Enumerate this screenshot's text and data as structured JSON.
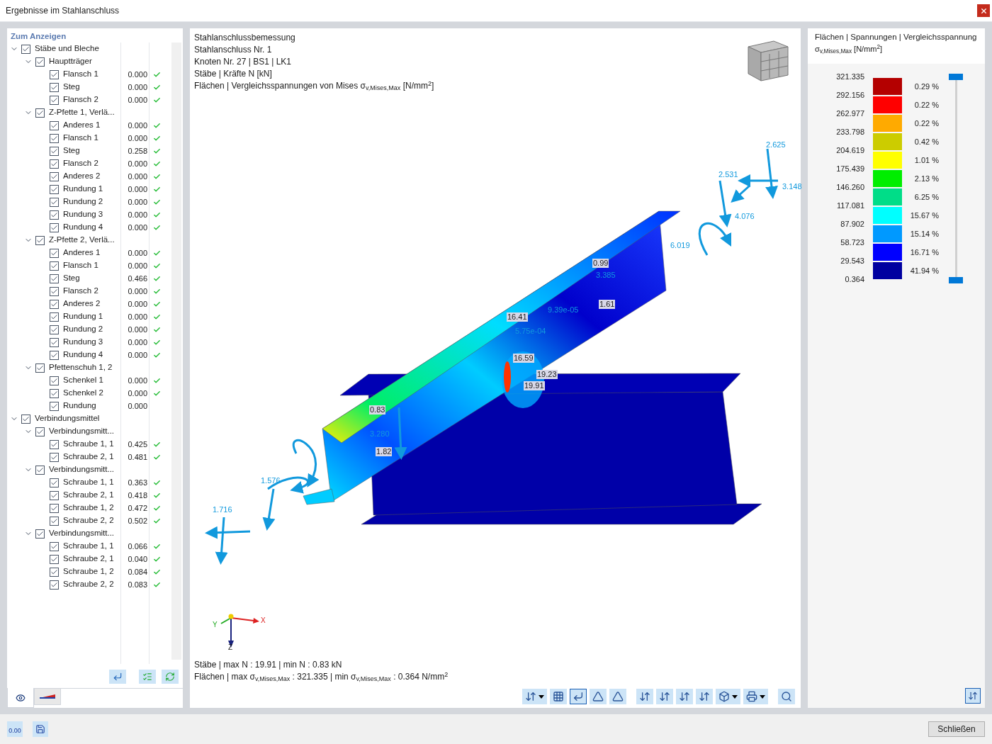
{
  "window": {
    "title": "Ergebnisse im Stahlanschluss"
  },
  "navigator": {
    "title": "Zum Anzeigen",
    "tree": [
      {
        "label": "Stäbe und Bleche",
        "checked": true,
        "expanded": true,
        "children": [
          {
            "label": "Hauptträger",
            "checked": true,
            "expanded": true,
            "children": [
              {
                "label": "Flansch 1",
                "checked": true,
                "value": "0.000",
                "ok": true
              },
              {
                "label": "Steg",
                "checked": true,
                "value": "0.000",
                "ok": true
              },
              {
                "label": "Flansch 2",
                "checked": true,
                "value": "0.000",
                "ok": true
              }
            ]
          },
          {
            "label": "Z-Pfette 1, Verlä...",
            "checked": true,
            "expanded": true,
            "children": [
              {
                "label": "Anderes 1",
                "checked": true,
                "value": "0.000",
                "ok": true
              },
              {
                "label": "Flansch 1",
                "checked": true,
                "value": "0.000",
                "ok": true
              },
              {
                "label": "Steg",
                "checked": true,
                "value": "0.258",
                "ok": true
              },
              {
                "label": "Flansch 2",
                "checked": true,
                "value": "0.000",
                "ok": true
              },
              {
                "label": "Anderes 2",
                "checked": true,
                "value": "0.000",
                "ok": true
              },
              {
                "label": "Rundung 1",
                "checked": true,
                "value": "0.000",
                "ok": true
              },
              {
                "label": "Rundung 2",
                "checked": true,
                "value": "0.000",
                "ok": true
              },
              {
                "label": "Rundung 3",
                "checked": true,
                "value": "0.000",
                "ok": true
              },
              {
                "label": "Rundung 4",
                "checked": true,
                "value": "0.000",
                "ok": true
              }
            ]
          },
          {
            "label": "Z-Pfette 2, Verlä...",
            "checked": true,
            "expanded": true,
            "children": [
              {
                "label": "Anderes 1",
                "checked": true,
                "value": "0.000",
                "ok": true
              },
              {
                "label": "Flansch 1",
                "checked": true,
                "value": "0.000",
                "ok": true
              },
              {
                "label": "Steg",
                "checked": true,
                "value": "0.466",
                "ok": true
              },
              {
                "label": "Flansch 2",
                "checked": true,
                "value": "0.000",
                "ok": true
              },
              {
                "label": "Anderes 2",
                "checked": true,
                "value": "0.000",
                "ok": true
              },
              {
                "label": "Rundung 1",
                "checked": true,
                "value": "0.000",
                "ok": true
              },
              {
                "label": "Rundung 2",
                "checked": true,
                "value": "0.000",
                "ok": true
              },
              {
                "label": "Rundung 3",
                "checked": true,
                "value": "0.000",
                "ok": true
              },
              {
                "label": "Rundung 4",
                "checked": true,
                "value": "0.000",
                "ok": true
              }
            ]
          },
          {
            "label": "Pfettenschuh 1, 2",
            "checked": true,
            "expanded": true,
            "children": [
              {
                "label": "Schenkel 1",
                "checked": true,
                "value": "0.000",
                "ok": true
              },
              {
                "label": "Schenkel 2",
                "checked": true,
                "value": "0.000",
                "ok": true
              },
              {
                "label": "Rundung",
                "checked": true,
                "value": "0.000",
                "ok": false
              }
            ]
          }
        ]
      },
      {
        "label": "Verbindungsmittel",
        "checked": true,
        "expanded": true,
        "children": [
          {
            "label": "Verbindungsmitt...",
            "checked": true,
            "expanded": true,
            "children": [
              {
                "label": "Schraube 1, 1",
                "checked": true,
                "value": "0.425",
                "ok": true
              },
              {
                "label": "Schraube 2, 1",
                "checked": true,
                "value": "0.481",
                "ok": true
              }
            ]
          },
          {
            "label": "Verbindungsmitt...",
            "checked": true,
            "expanded": true,
            "children": [
              {
                "label": "Schraube 1, 1",
                "checked": true,
                "value": "0.363",
                "ok": true
              },
              {
                "label": "Schraube 2, 1",
                "checked": true,
                "value": "0.418",
                "ok": true
              },
              {
                "label": "Schraube 1, 2",
                "checked": true,
                "value": "0.472",
                "ok": true
              },
              {
                "label": "Schraube 2, 2",
                "checked": true,
                "value": "0.502",
                "ok": true
              }
            ]
          },
          {
            "label": "Verbindungsmitt...",
            "checked": true,
            "expanded": true,
            "children": [
              {
                "label": "Schraube 1, 1",
                "checked": true,
                "value": "0.066",
                "ok": true
              },
              {
                "label": "Schraube 2, 1",
                "checked": true,
                "value": "0.040",
                "ok": true
              },
              {
                "label": "Schraube 1, 2",
                "checked": true,
                "value": "0.084",
                "ok": true
              },
              {
                "label": "Schraube 2, 2",
                "checked": true,
                "value": "0.083",
                "ok": true
              }
            ]
          }
        ]
      }
    ],
    "tabs": [
      {
        "kind": "visibility",
        "selected": true
      },
      {
        "kind": "colors",
        "selected": false
      }
    ]
  },
  "view": {
    "info": [
      "Stahlanschlussbemessung",
      "Stahlanschluss Nr. 1",
      "Knoten Nr. 27 | BS1 | LK1",
      "Stäbe | Kräfte N [kN]",
      "Flächen | Vergleichsspannungen von Mises σ$_{v,Mises,Max}$ [N/mm$^{2}$]"
    ],
    "member_labels": [
      "0.99",
      "1.61",
      "16.41",
      "16.59",
      "19.23",
      "19.91",
      "0.83",
      "1.82"
    ],
    "force_labels": [
      "2.625",
      "2.531",
      "3.148",
      "4.076",
      "6.019",
      "3.385",
      "9.39e-05",
      "5.75e-04",
      "3.280",
      "1.576",
      "1.716"
    ],
    "axes": {
      "x": "X",
      "y": "Y",
      "z": "Z"
    },
    "summary": [
      "Stäbe | max N : 19.91 | min N : 0.83 kN",
      "Flächen | max σ$_{v,Mises,Max}$ : 321.335 | min σ$_{v,Mises,Max}$ : 0.364 N/mm$^{2}$"
    ],
    "toolbar": [
      {
        "kind": "display",
        "selected": false
      },
      {
        "kind": "mesh",
        "selected": false
      },
      {
        "kind": "supports",
        "selected": true
      },
      {
        "kind": "loads",
        "selected": false
      },
      {
        "kind": "dimensions",
        "selected": false
      },
      {
        "kind": "view-x",
        "selected": false
      },
      {
        "kind": "view-y",
        "selected": false
      },
      {
        "kind": "view-z",
        "selected": false
      },
      {
        "kind": "view-minus-z",
        "selected": false
      },
      {
        "kind": "iso",
        "selected": false
      },
      {
        "kind": "print",
        "selected": false
      },
      {
        "kind": "reset",
        "selected": false
      }
    ]
  },
  "legend": {
    "title": "Flächen | Spannungen | Vergleichsspannung",
    "subtitle": "σ$_{v,Mises,Max}$ [N/mm$^{2}$]",
    "values": [
      "321.335",
      "292.156",
      "262.977",
      "233.798",
      "204.619",
      "175.439",
      "146.260",
      "117.081",
      "87.902",
      "58.723",
      "29.543",
      "0.364"
    ],
    "bands": [
      {
        "color": "#b40000",
        "percent": "0.29 %"
      },
      {
        "color": "#ff0000",
        "percent": "0.22 %"
      },
      {
        "color": "#ffaa00",
        "percent": "0.22 %"
      },
      {
        "color": "#cccc00",
        "percent": "0.42 %"
      },
      {
        "color": "#ffff00",
        "percent": "1.01 %"
      },
      {
        "color": "#00ee00",
        "percent": "2.13 %"
      },
      {
        "color": "#00dd88",
        "percent": "6.25 %"
      },
      {
        "color": "#00ffff",
        "percent": "15.67 %"
      },
      {
        "color": "#0099ff",
        "percent": "15.14 %"
      },
      {
        "color": "#0000ff",
        "percent": "16.71 %"
      },
      {
        "color": "#0000a0",
        "percent": "41.94 %"
      }
    ]
  },
  "scale_slider": {
    "level": 1
  },
  "footer": {
    "decimals": "0.00",
    "close": "Schließen"
  }
}
